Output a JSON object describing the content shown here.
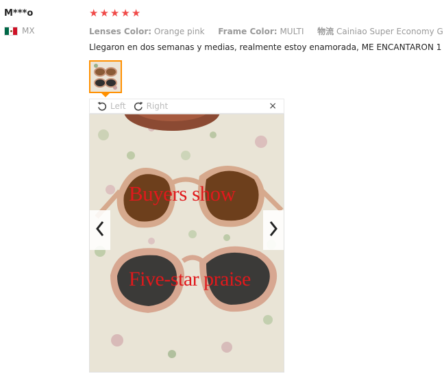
{
  "reviewer": {
    "name": "M***o",
    "country_code": "MX",
    "flag": "mexico-flag",
    "rating": 5
  },
  "review": {
    "stars": [
      "★",
      "★",
      "★",
      "★",
      "★"
    ],
    "attributes": [
      {
        "key": "Lenses Color:",
        "value": "Orange pink"
      },
      {
        "key": "Frame Color:",
        "value": "MULTI"
      },
      {
        "key": "物流",
        "value": "Cainiao Super Economy Globa"
      }
    ],
    "text": "Llegaron en dos semanas y medias, realmente estoy enamorada, ME ENCANTARON",
    "text_tail": "1"
  },
  "image_viewer": {
    "rotate_left_label": "Left",
    "rotate_right_label": "Right",
    "close_symbol": "×",
    "watermark_top": "Buyers show",
    "watermark_bottom": "Five-star praise"
  },
  "colors": {
    "star": "#f04a48",
    "thumb_border": "#ff9000",
    "watermark": "#e0191c"
  }
}
